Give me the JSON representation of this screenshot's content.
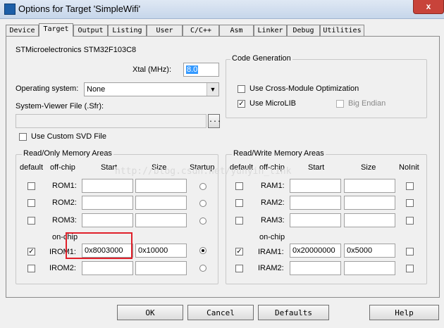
{
  "window": {
    "title": "Options for Target 'SimpleWifi'",
    "close": "x"
  },
  "tabs": [
    "Device",
    "Target",
    "Output",
    "Listing",
    "User",
    "C/C++",
    "Asm",
    "Linker",
    "Debug",
    "Utilities"
  ],
  "device": "STMicroelectronics STM32F103C8",
  "xtal": {
    "label": "Xtal (MHz):",
    "value": "8.0"
  },
  "os": {
    "label": "Operating system:",
    "value": "None"
  },
  "sfr": {
    "label": "System-Viewer File (.Sfr):",
    "value": "",
    "browse": "..."
  },
  "custom_svd": {
    "label": "Use Custom SVD File",
    "checked": false
  },
  "code_gen": {
    "title": "Code Generation",
    "cross_module": {
      "label": "Use Cross-Module Optimization",
      "checked": false
    },
    "microlib": {
      "label": "Use MicroLIB",
      "checked": true
    },
    "big_endian": {
      "label": "Big Endian",
      "checked": false,
      "disabled": true
    }
  },
  "rom": {
    "title": "Read/Only Memory Areas",
    "headers": {
      "default": "default",
      "offchip": "off-chip",
      "start": "Start",
      "size": "Size",
      "startup": "Startup"
    },
    "onchip_label": "on-chip",
    "rows": [
      {
        "label": "ROM1:",
        "start": "",
        "size": "",
        "default": false,
        "startup": false
      },
      {
        "label": "ROM2:",
        "start": "",
        "size": "",
        "default": false,
        "startup": false
      },
      {
        "label": "ROM3:",
        "start": "",
        "size": "",
        "default": false,
        "startup": false
      },
      {
        "label": "IROM1:",
        "start": "0x8003000",
        "size": "0x10000",
        "default": true,
        "startup": true
      },
      {
        "label": "IROM2:",
        "start": "",
        "size": "",
        "default": false,
        "startup": false
      }
    ]
  },
  "ram": {
    "title": "Read/Write Memory Areas",
    "headers": {
      "default": "default",
      "offchip": "off-chip",
      "start": "Start",
      "size": "Size",
      "noinit": "NoInit"
    },
    "onchip_label": "on-chip",
    "rows": [
      {
        "label": "RAM1:",
        "start": "",
        "size": "",
        "default": false,
        "noinit": false
      },
      {
        "label": "RAM2:",
        "start": "",
        "size": "",
        "default": false,
        "noinit": false
      },
      {
        "label": "RAM3:",
        "start": "",
        "size": "",
        "default": false,
        "noinit": false
      },
      {
        "label": "IRAM1:",
        "start": "0x20000000",
        "size": "0x5000",
        "default": true,
        "noinit": false
      },
      {
        "label": "IRAM2:",
        "start": "",
        "size": "",
        "default": false,
        "noinit": false
      }
    ]
  },
  "watermark": "http://blog.csdn.net/yunyin_link",
  "buttons": {
    "ok": "OK",
    "cancel": "Cancel",
    "defaults": "Defaults",
    "help": "Help"
  }
}
